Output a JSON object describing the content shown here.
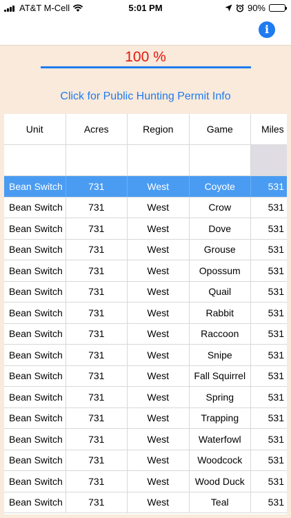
{
  "status": {
    "carrier": "AT&T M-Cell",
    "time": "5:01 PM",
    "battery": "90%",
    "battery_level": 0.9
  },
  "header": {
    "info_icon": "info-icon",
    "info_label": "i"
  },
  "progress": {
    "label": "100 %",
    "value": 1.0
  },
  "link": {
    "text": "Click for Public Hunting Permit Info"
  },
  "table": {
    "columns": [
      "Unit",
      "Acres",
      "Region",
      "Game",
      "Miles"
    ],
    "filter": [
      "",
      "",
      "",
      "",
      ""
    ],
    "rows": [
      [
        "Bean Switch",
        "731",
        "West",
        "Coyote",
        "531"
      ],
      [
        "Bean Switch",
        "731",
        "West",
        "Crow",
        "531"
      ],
      [
        "Bean Switch",
        "731",
        "West",
        "Dove",
        "531"
      ],
      [
        "Bean Switch",
        "731",
        "West",
        "Grouse",
        "531"
      ],
      [
        "Bean Switch",
        "731",
        "West",
        "Opossum",
        "531"
      ],
      [
        "Bean Switch",
        "731",
        "West",
        "Quail",
        "531"
      ],
      [
        "Bean Switch",
        "731",
        "West",
        "Rabbit",
        "531"
      ],
      [
        "Bean Switch",
        "731",
        "West",
        "Raccoon",
        "531"
      ],
      [
        "Bean Switch",
        "731",
        "West",
        "Snipe",
        "531"
      ],
      [
        "Bean Switch",
        "731",
        "West",
        "Fall Squirrel",
        "531"
      ],
      [
        "Bean Switch",
        "731",
        "West",
        "Spring",
        "531"
      ],
      [
        "Bean Switch",
        "731",
        "West",
        "Trapping",
        "531"
      ],
      [
        "Bean Switch",
        "731",
        "West",
        "Waterfowl",
        "531"
      ],
      [
        "Bean Switch",
        "731",
        "West",
        "Woodcock",
        "531"
      ],
      [
        "Bean Switch",
        "731",
        "West",
        "Wood Duck",
        "531"
      ],
      [
        "Bean Switch",
        "731",
        "West",
        "Teal",
        "531"
      ]
    ],
    "selected_row": 0
  },
  "colors": {
    "accent": "#1e7bf0",
    "percent": "#e3180f",
    "selected_row": "#4a9cf2",
    "background": "#f9eadb"
  }
}
